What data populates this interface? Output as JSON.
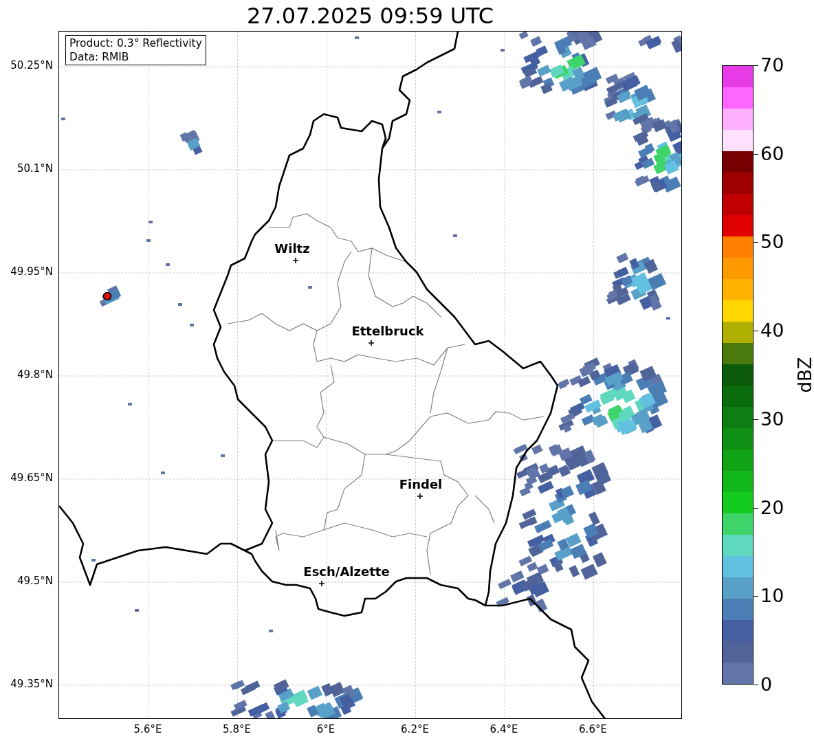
{
  "title": "27.07.2025 09:59 UTC",
  "map": {
    "info_box": [
      "Product: 0.3° Reflectivity",
      "Data: RMIB"
    ],
    "lat_ticks": [
      "50.25°N",
      "50.1°N",
      "49.95°N",
      "49.8°N",
      "49.65°N",
      "49.5°N",
      "49.35°N"
    ],
    "lon_ticks": [
      "5.6°E",
      "5.8°E",
      "6°E",
      "6.2°E",
      "6.4°E",
      "6.6°E"
    ],
    "places": [
      {
        "name": "Wiltz"
      },
      {
        "name": "Ettelbruck"
      },
      {
        "name": "Findel"
      },
      {
        "name": "Esch/Alzette"
      }
    ]
  },
  "colorbar": {
    "label": "dBZ",
    "ticks": [
      "70",
      "60",
      "50",
      "40",
      "30",
      "20",
      "10",
      "0"
    ],
    "bins": [
      {
        "color": "#e83ce8"
      },
      {
        "color": "#ff66ff"
      },
      {
        "color": "#ffb0ff"
      },
      {
        "color": "#ffe0ff"
      },
      {
        "color": "#780000"
      },
      {
        "color": "#9e0000"
      },
      {
        "color": "#c00000"
      },
      {
        "color": "#e00000"
      },
      {
        "color": "#ff7f00"
      },
      {
        "color": "#ff9900"
      },
      {
        "color": "#ffb300"
      },
      {
        "color": "#ffd700"
      },
      {
        "color": "#b0b000"
      },
      {
        "color": "#4a7a0e"
      },
      {
        "color": "#0a5a0a"
      },
      {
        "color": "#0a6c0a"
      },
      {
        "color": "#0e7e12"
      },
      {
        "color": "#0f8f14"
      },
      {
        "color": "#11a316"
      },
      {
        "color": "#12b81a"
      },
      {
        "color": "#14cc1e"
      },
      {
        "color": "#3ed46a"
      },
      {
        "color": "#60d8c0"
      },
      {
        "color": "#62c0e0"
      },
      {
        "color": "#58a0c8"
      },
      {
        "color": "#4a7eb5"
      },
      {
        "color": "#445fa2"
      },
      {
        "color": "#50649a"
      },
      {
        "color": "#6275a8"
      }
    ]
  }
}
